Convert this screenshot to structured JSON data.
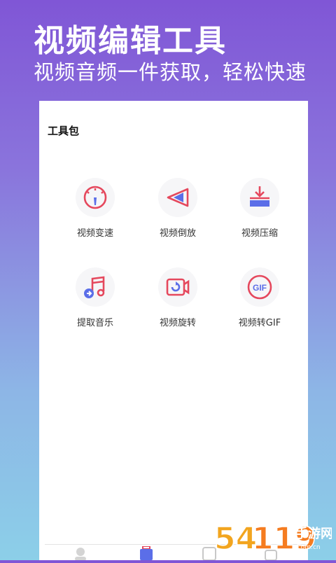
{
  "promo": {
    "title": "视频编辑工具",
    "subtitle": "视频音频一件获取，轻松快速"
  },
  "section": {
    "title": "工具包"
  },
  "tools": [
    {
      "label": "视频变速",
      "icon": "speedometer-icon"
    },
    {
      "label": "视频倒放",
      "icon": "reverse-play-icon"
    },
    {
      "label": "视频压缩",
      "icon": "compress-icon"
    },
    {
      "label": "提取音乐",
      "icon": "music-extract-icon"
    },
    {
      "label": "视频旋转",
      "icon": "rotate-video-icon"
    },
    {
      "label": "视频转GIF",
      "icon": "gif-icon"
    }
  ],
  "tabbar": {
    "tabs": [
      "person-tab-icon",
      "toolbox-tab-icon",
      "document-tab-icon",
      "more-tab-icon"
    ]
  },
  "watermark": {
    "text": "54119手游网",
    "domain": "www.54119.com.cn"
  },
  "colors": {
    "accent_red": "#e5485d",
    "accent_blue": "#5b6ee8",
    "gradient_top": "#8056d6",
    "gradient_bottom": "#8ccfe8"
  }
}
